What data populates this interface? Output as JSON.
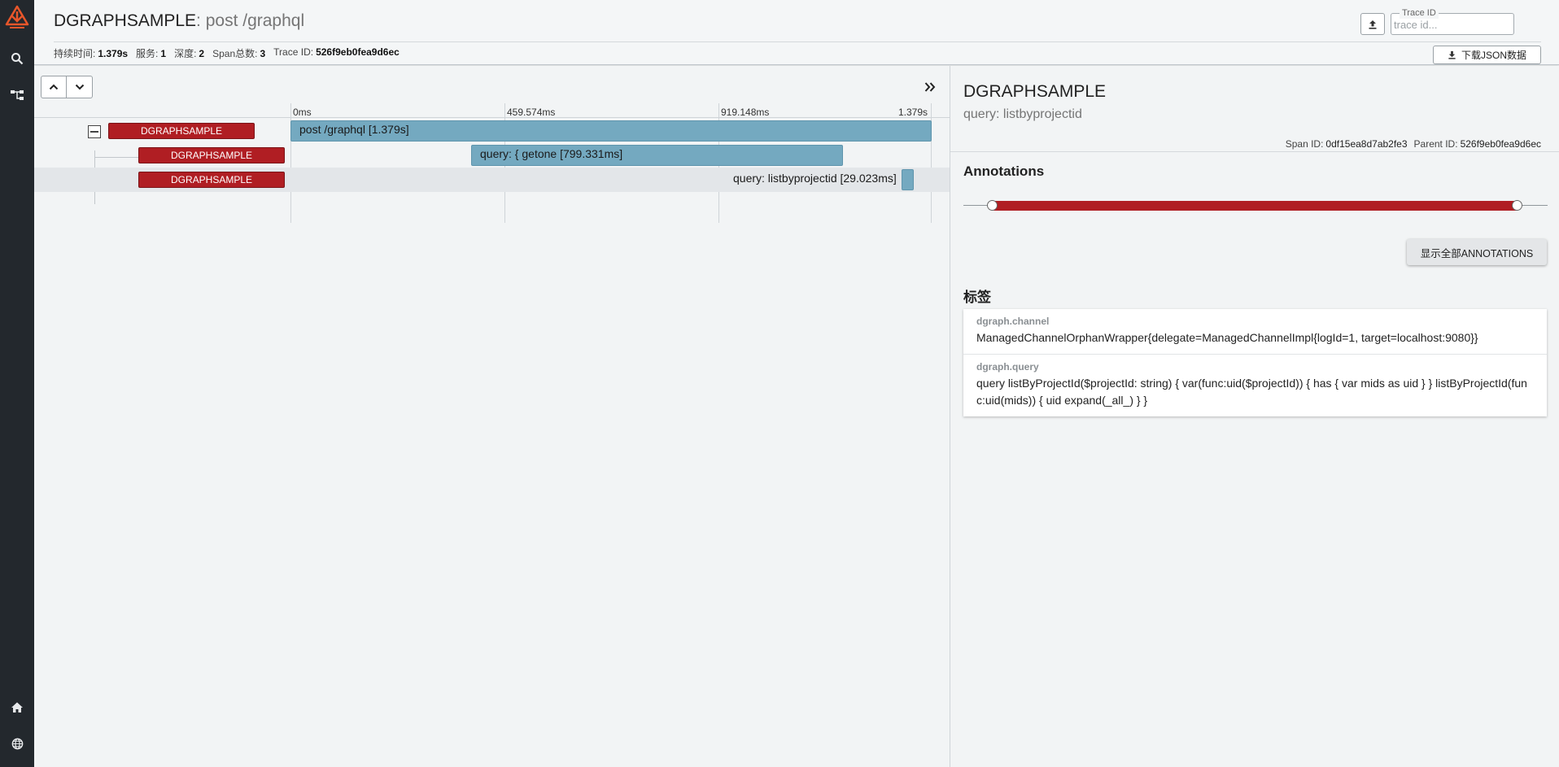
{
  "app": {
    "service": "DGRAPHSAMPLE",
    "operation": ": post /graphql"
  },
  "meta": {
    "duration_label": "持续时间:",
    "duration": "1.379s",
    "services_label": "服务:",
    "services": "1",
    "depth_label": "深度:",
    "depth": "2",
    "spans_label": "Span总数:",
    "spans": "3",
    "traceid_label": "Trace ID:",
    "traceid": "526f9eb0fea9d6ec"
  },
  "trace_search": {
    "label": "Trace ID",
    "placeholder": "trace id..."
  },
  "download_label": "下载JSON数据",
  "timeline": {
    "ticks": [
      "0ms",
      "459.574ms",
      "919.148ms",
      "1.379s"
    ],
    "rows": [
      {
        "service": "DGRAPHSAMPLE",
        "label": "post /graphql [1.379s]",
        "start": 0,
        "duration": 1379,
        "selected": false
      },
      {
        "service": "DGRAPHSAMPLE",
        "label": "query: { getone [799.331ms]",
        "start": 283,
        "duration": 799.331,
        "selected": false
      },
      {
        "service": "DGRAPHSAMPLE",
        "label": "query: listbyprojectid [29.023ms]",
        "start": 1348,
        "duration": 29.023,
        "selected": true
      }
    ]
  },
  "detail": {
    "service": "DGRAPHSAMPLE",
    "operation": "query: listbyprojectid",
    "span_id_label": "Span ID:",
    "span_id": "0df15ea8d7ab2fe3",
    "parent_id_label": "Parent ID:",
    "parent_id": "526f9eb0fea9d6ec",
    "annotations_heading": "Annotations",
    "show_all_label": "显示全部ANNOTATIONS",
    "tags_heading": "标签",
    "tags": [
      {
        "key": "dgraph.channel",
        "value": "ManagedChannelOrphanWrapper{delegate=ManagedChannelImpl{logId=1, target=localhost:9080}}"
      },
      {
        "key": "dgraph.query",
        "value": "query listByProjectId($projectId: string) { var(func:uid($projectId)) { has { var mids as uid } } listByProjectId(func:uid(mids)) { uid expand(_all_) } }"
      }
    ]
  },
  "colors": {
    "service_bar": "#b01e23",
    "span_bar": "#74a9c0",
    "rail": "#23282d",
    "logo": "#e8562a"
  }
}
